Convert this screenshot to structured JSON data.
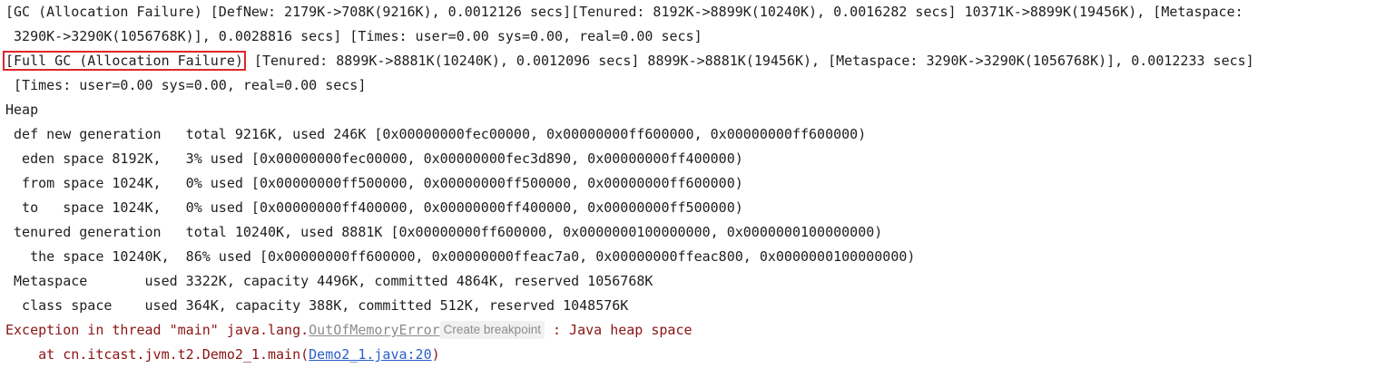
{
  "console": {
    "lines": {
      "l1": "[GC (Allocation Failure) [DefNew: 2179K->708K(9216K), 0.0012126 secs][Tenured: 8192K->8899K(10240K), 0.0016282 secs] 10371K->8899K(19456K), [Metaspace:",
      "l2": " 3290K->3290K(1056768K)], 0.0028816 secs] [Times: user=0.00 sys=0.00, real=0.00 secs]",
      "l3_highlight": "[Full GC (Allocation Failure)",
      "l3_rest": " [Tenured: 8899K->8881K(10240K), 0.0012096 secs] 8899K->8881K(19456K), [Metaspace: 3290K->3290K(1056768K)], 0.0012233 secs]",
      "l4": " [Times: user=0.00 sys=0.00, real=0.00 secs]",
      "l5": "Heap",
      "l6": " def new generation   total 9216K, used 246K [0x00000000fec00000, 0x00000000ff600000, 0x00000000ff600000)",
      "l7": "  eden space 8192K,   3% used [0x00000000fec00000, 0x00000000fec3d890, 0x00000000ff400000)",
      "l8": "  from space 1024K,   0% used [0x00000000ff500000, 0x00000000ff500000, 0x00000000ff600000)",
      "l9": "  to   space 1024K,   0% used [0x00000000ff400000, 0x00000000ff400000, 0x00000000ff500000)",
      "l10": " tenured generation   total 10240K, used 8881K [0x00000000ff600000, 0x0000000100000000, 0x0000000100000000)",
      "l11": "   the space 10240K,  86% used [0x00000000ff600000, 0x00000000ffeac7a0, 0x00000000ffeac800, 0x0000000100000000)",
      "l12": " Metaspace       used 3322K, capacity 4496K, committed 4864K, reserved 1056768K",
      "l13": "  class space    used 364K, capacity 388K, committed 512K, reserved 1048576K"
    },
    "exception": {
      "prefix": "Exception in thread \"main\" java.lang.",
      "class_link": "OutOfMemoryError",
      "breakpoint_chip": "Create breakpoint",
      "suffix": " : Java heap space"
    },
    "stack": {
      "prefix": "    at cn.itcast.jvm.t2.Demo2_1.main(",
      "file_link": "Demo2_1.java:20",
      "suffix": ")"
    }
  },
  "colors": {
    "error_text": "#8a1414",
    "highlight_border": "#e0262b",
    "link_blue": "#2a5ec8",
    "link_gray": "#8c8c8c"
  }
}
